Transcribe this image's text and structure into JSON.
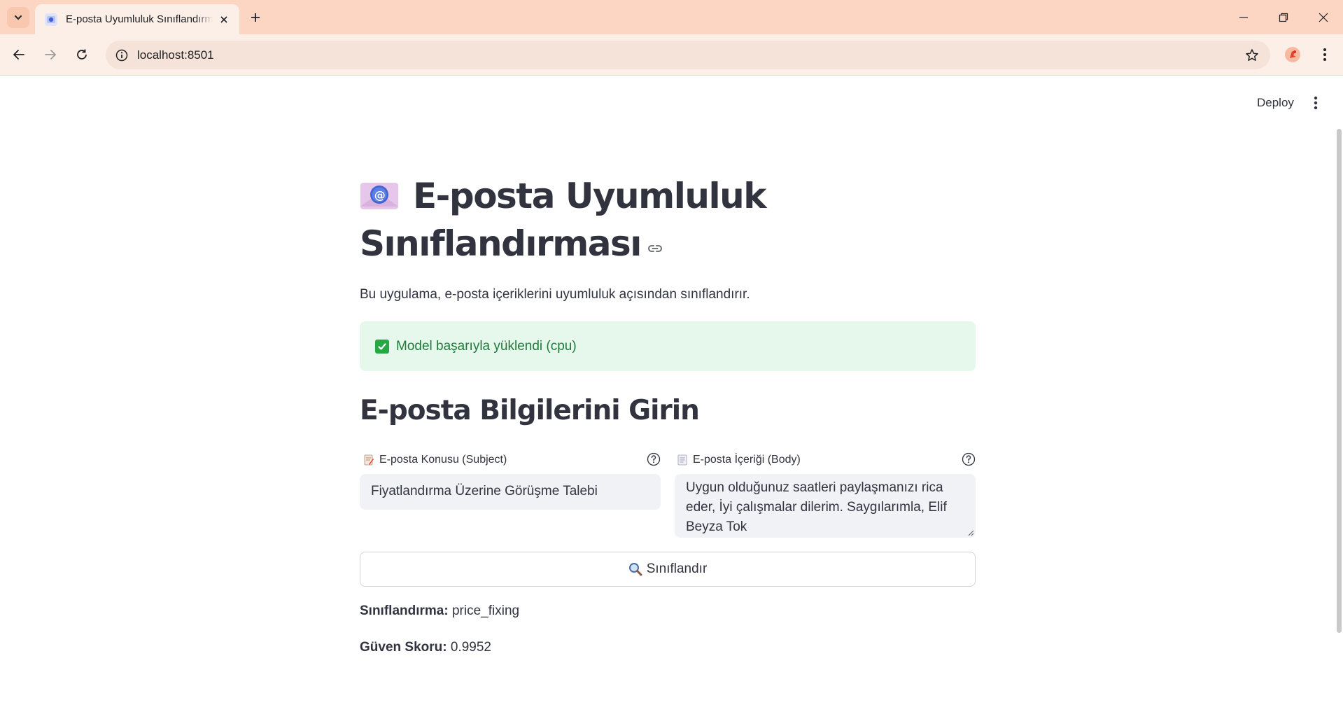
{
  "browser": {
    "tab_title": "E-posta Uyumluluk Sınıflandırması",
    "url": "localhost:8501"
  },
  "app": {
    "deploy_label": "Deploy",
    "title_line1": "E-posta Uyumluluk",
    "title_line2": "Sınıflandırması",
    "title_emoji": "e-mail-emoji",
    "subtitle": "Bu uygulama, e-posta içeriklerini uyumluluk açısından sınıflandırır.",
    "success_message": "Model başarıyla yüklendi (cpu)",
    "section_header": "E-posta Bilgilerini Girin",
    "subject": {
      "label": "E-posta Konusu (Subject)",
      "value": "Fiyatlandırma Üzerine Görüşme Talebi"
    },
    "body": {
      "label": "E-posta İçeriği (Body)",
      "value": "Uygun olduğunuz saatleri paylaşmanızı rica eder, İyi çalışmalar dilerim. Saygılarımla, Elif Beyza Tok"
    },
    "classify_button": "Sınıflandır",
    "result": {
      "classification_label": "Sınıflandırma:",
      "classification_value": "price_fixing",
      "confidence_label": "Güven Skoru:",
      "confidence_value": "0.9952"
    }
  },
  "colors": {
    "tabbar": "#fcd6c3",
    "toolbar": "#fcefe8",
    "success_bg": "#e6f8ec",
    "success_text": "#1f7a3a",
    "input_bg": "#f0f2f6"
  }
}
